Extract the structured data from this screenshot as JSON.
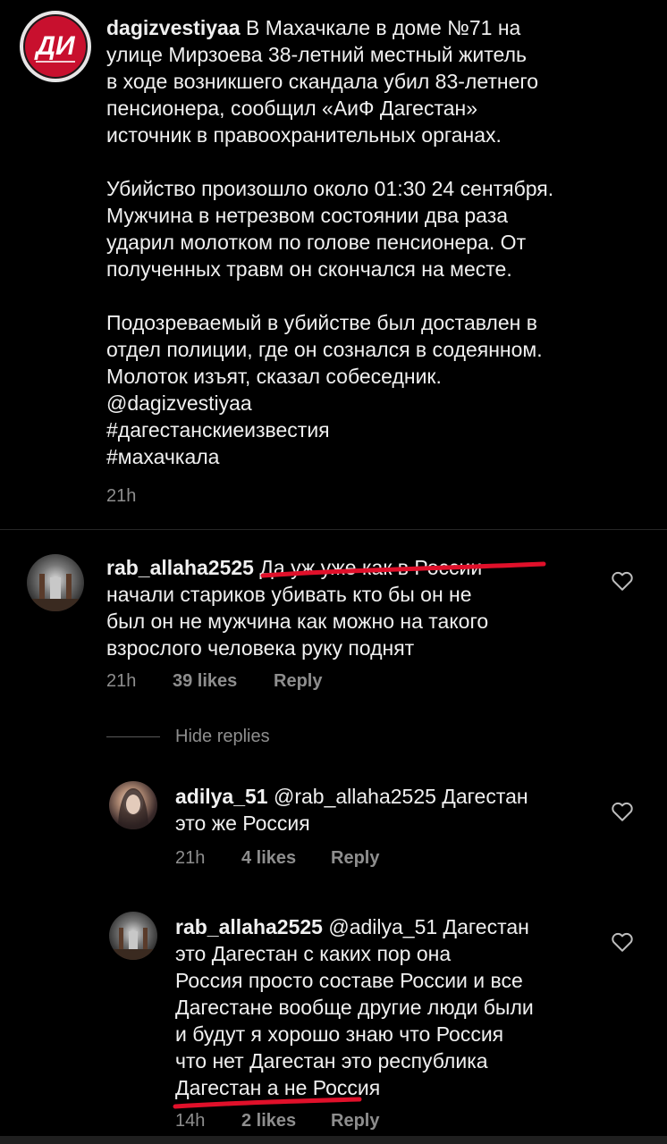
{
  "post": {
    "avatar_icon": "aif-dagestan-logo",
    "username": "dagizvestiyaa",
    "lines": [
      " В Махачкале в доме №71 на",
      "улице Мирзоева 38-летний местный житель",
      "в ходе возникшего скандала убил 83-летнего",
      "пенсионера, сообщил «АиФ Дагестан»",
      "источник в правоохранительных органах."
    ],
    "para2": [
      "Убийство произошло около 01:30 24 сентября.",
      "Мужчина в нетрезвом состоянии два раза",
      "ударил молотком по голове пенсионера. От",
      "полученных травм он скончался на месте."
    ],
    "para3": [
      "Подозреваемый в убийстве был доставлен в",
      "отдел полиции, где он сознался в содеянном.",
      "Молоток изъят, сказал собеседник.",
      "@dagizvestiyaa",
      "#дагестанскиеизвестия",
      "#махачкала"
    ],
    "time": "21h"
  },
  "comments": [
    {
      "username": "rab_allaha2525",
      "lines": [
        " Да уж уже как в России",
        "начали стариков убивать кто бы он не",
        "был он не мужчина как можно на такого",
        "взрослого человека руку поднят"
      ],
      "time": "21h",
      "likes": "39 likes",
      "reply": "Reply",
      "heart_icon": "heart-outline-icon"
    }
  ],
  "hide_replies": "Hide replies",
  "replies": [
    {
      "username": "adilya_51",
      "lines": [
        " @rab_allaha2525 Дагестан",
        "это же Россия"
      ],
      "time": "21h",
      "likes": "4 likes",
      "reply": "Reply"
    },
    {
      "username": "rab_allaha2525",
      "lines": [
        " @adilya_51 Дагестан",
        "это Дагестан с каких пор она",
        "Россия просто составе России и все",
        "Дагестане вообще другие люди были",
        "и будут я хорошо знаю что Россия",
        "что нет Дагестан это республика",
        "Дагестан а не Россия"
      ],
      "time": "14h",
      "likes": "2 likes",
      "reply": "Reply"
    }
  ],
  "colors": {
    "background": "#000000",
    "text": "#f0f0f0",
    "muted": "#8e8e8e",
    "annotation_red": "#e0102a"
  }
}
